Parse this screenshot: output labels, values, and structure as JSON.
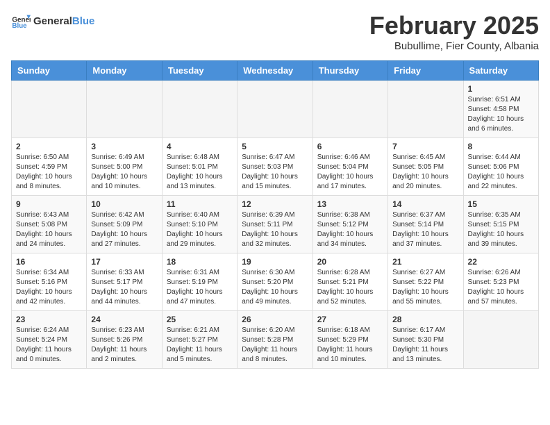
{
  "header": {
    "logo_general": "General",
    "logo_blue": "Blue",
    "month_title": "February 2025",
    "location": "Bubullime, Fier County, Albania"
  },
  "weekdays": [
    "Sunday",
    "Monday",
    "Tuesday",
    "Wednesday",
    "Thursday",
    "Friday",
    "Saturday"
  ],
  "weeks": [
    [
      {
        "day": "",
        "info": ""
      },
      {
        "day": "",
        "info": ""
      },
      {
        "day": "",
        "info": ""
      },
      {
        "day": "",
        "info": ""
      },
      {
        "day": "",
        "info": ""
      },
      {
        "day": "",
        "info": ""
      },
      {
        "day": "1",
        "info": "Sunrise: 6:51 AM\nSunset: 4:58 PM\nDaylight: 10 hours and 6 minutes."
      }
    ],
    [
      {
        "day": "2",
        "info": "Sunrise: 6:50 AM\nSunset: 4:59 PM\nDaylight: 10 hours and 8 minutes."
      },
      {
        "day": "3",
        "info": "Sunrise: 6:49 AM\nSunset: 5:00 PM\nDaylight: 10 hours and 10 minutes."
      },
      {
        "day": "4",
        "info": "Sunrise: 6:48 AM\nSunset: 5:01 PM\nDaylight: 10 hours and 13 minutes."
      },
      {
        "day": "5",
        "info": "Sunrise: 6:47 AM\nSunset: 5:03 PM\nDaylight: 10 hours and 15 minutes."
      },
      {
        "day": "6",
        "info": "Sunrise: 6:46 AM\nSunset: 5:04 PM\nDaylight: 10 hours and 17 minutes."
      },
      {
        "day": "7",
        "info": "Sunrise: 6:45 AM\nSunset: 5:05 PM\nDaylight: 10 hours and 20 minutes."
      },
      {
        "day": "8",
        "info": "Sunrise: 6:44 AM\nSunset: 5:06 PM\nDaylight: 10 hours and 22 minutes."
      }
    ],
    [
      {
        "day": "9",
        "info": "Sunrise: 6:43 AM\nSunset: 5:08 PM\nDaylight: 10 hours and 24 minutes."
      },
      {
        "day": "10",
        "info": "Sunrise: 6:42 AM\nSunset: 5:09 PM\nDaylight: 10 hours and 27 minutes."
      },
      {
        "day": "11",
        "info": "Sunrise: 6:40 AM\nSunset: 5:10 PM\nDaylight: 10 hours and 29 minutes."
      },
      {
        "day": "12",
        "info": "Sunrise: 6:39 AM\nSunset: 5:11 PM\nDaylight: 10 hours and 32 minutes."
      },
      {
        "day": "13",
        "info": "Sunrise: 6:38 AM\nSunset: 5:12 PM\nDaylight: 10 hours and 34 minutes."
      },
      {
        "day": "14",
        "info": "Sunrise: 6:37 AM\nSunset: 5:14 PM\nDaylight: 10 hours and 37 minutes."
      },
      {
        "day": "15",
        "info": "Sunrise: 6:35 AM\nSunset: 5:15 PM\nDaylight: 10 hours and 39 minutes."
      }
    ],
    [
      {
        "day": "16",
        "info": "Sunrise: 6:34 AM\nSunset: 5:16 PM\nDaylight: 10 hours and 42 minutes."
      },
      {
        "day": "17",
        "info": "Sunrise: 6:33 AM\nSunset: 5:17 PM\nDaylight: 10 hours and 44 minutes."
      },
      {
        "day": "18",
        "info": "Sunrise: 6:31 AM\nSunset: 5:19 PM\nDaylight: 10 hours and 47 minutes."
      },
      {
        "day": "19",
        "info": "Sunrise: 6:30 AM\nSunset: 5:20 PM\nDaylight: 10 hours and 49 minutes."
      },
      {
        "day": "20",
        "info": "Sunrise: 6:28 AM\nSunset: 5:21 PM\nDaylight: 10 hours and 52 minutes."
      },
      {
        "day": "21",
        "info": "Sunrise: 6:27 AM\nSunset: 5:22 PM\nDaylight: 10 hours and 55 minutes."
      },
      {
        "day": "22",
        "info": "Sunrise: 6:26 AM\nSunset: 5:23 PM\nDaylight: 10 hours and 57 minutes."
      }
    ],
    [
      {
        "day": "23",
        "info": "Sunrise: 6:24 AM\nSunset: 5:24 PM\nDaylight: 11 hours and 0 minutes."
      },
      {
        "day": "24",
        "info": "Sunrise: 6:23 AM\nSunset: 5:26 PM\nDaylight: 11 hours and 2 minutes."
      },
      {
        "day": "25",
        "info": "Sunrise: 6:21 AM\nSunset: 5:27 PM\nDaylight: 11 hours and 5 minutes."
      },
      {
        "day": "26",
        "info": "Sunrise: 6:20 AM\nSunset: 5:28 PM\nDaylight: 11 hours and 8 minutes."
      },
      {
        "day": "27",
        "info": "Sunrise: 6:18 AM\nSunset: 5:29 PM\nDaylight: 11 hours and 10 minutes."
      },
      {
        "day": "28",
        "info": "Sunrise: 6:17 AM\nSunset: 5:30 PM\nDaylight: 11 hours and 13 minutes."
      },
      {
        "day": "",
        "info": ""
      }
    ]
  ]
}
